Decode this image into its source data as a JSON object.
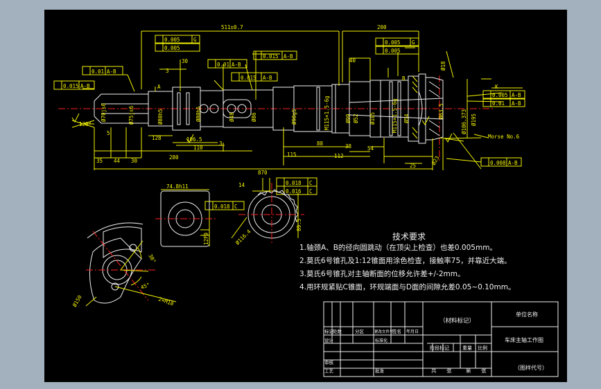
{
  "drawing": {
    "dims": {
      "d511": "511±0.7",
      "d200": "200",
      "d870": "870",
      "d280": "280",
      "d110": "110",
      "d106": "106.5",
      "d128": "128",
      "d88": "88",
      "d115": "115",
      "d38": "38",
      "d54": "54",
      "d112": "112",
      "d25": "25",
      "d35": "35",
      "d44": "44",
      "d30": "30",
      "d3a": "3",
      "d3b": "3",
      "d40": "40",
      "d5": "5",
      "d120": "120°",
      "d748": "74.8h11",
      "d14": "14",
      "d895": "89.5",
      "d1164": "Ø116.4",
      "d12": "12F9",
      "d150": "Ø150",
      "d45": "45°",
      "d30deg": "30°",
      "d2m10": "2×M10",
      "morse": "Morse No.6",
      "phi70": "Ø70js6",
      "phi75": "Ø75js6",
      "phi80": "Ø80h5",
      "phi48": "Ø48",
      "phi86": "Ø86",
      "phi90": "Ø90g5",
      "phi99": "Ø99",
      "phi105": "Ø105",
      "phi195": "Ø195",
      "phi106": "Ø106.373",
      "m115": "M115×1.5-6g",
      "phi18": "Ø18",
      "phi52": "Ø52",
      "phi54": "Ø54",
      "phi63": "Ø63.5",
      "phi23": "Ø23",
      "k": "K"
    },
    "tolerances": {
      "t1": "0.005",
      "t1d": "G",
      "t2": "0.005",
      "t3": "0.015",
      "t3d": "A-B",
      "t4": "0.01",
      "t4d": "A-B",
      "t5": "0.015",
      "t5d": "A-B",
      "t6": "0.01",
      "t6d": "A-B",
      "t7": "0.015",
      "t7d": "A-B",
      "t8": "0.005",
      "t8d": "G",
      "t9": "0.005",
      "t10": "0.005",
      "t10d": "A-B",
      "t11": "0.01",
      "t11d": "A-B",
      "t12": "0.008",
      "t12d": "A-B",
      "t13": "0.018",
      "t13d": "C",
      "t14": "0.016",
      "t14d": "C",
      "t15": "0.018",
      "t15d": "C",
      "label_a": "A",
      "label_b": "B"
    }
  },
  "notes": {
    "title": "技术要求",
    "items": [
      "1.轴颈A、B的径向圆跳动（在顶尖上检查）也差0.005mm。",
      "2.莫氏6号锥孔及1:12锥面用涂色检查，接触率75，并靠近大端。",
      "3.莫氏6号锥孔对主轴断面的位移允许差+/-2mm。",
      "4.用环规紧贴C锥面，环规端面与D面的间隙允差0.05~0.10mm。"
    ]
  },
  "title_block": {
    "material": "（材料标记）",
    "unit_name": "单位名称",
    "drawing_name": "车床主轴工作图",
    "drawing_code": "（图样代号）",
    "mark": "标记",
    "count": "处数",
    "zone": "分区",
    "change_doc": "更改文件号",
    "signature": "签名",
    "date": "年月日",
    "design": "设计",
    "standardize": "标准化",
    "stage_mark": "阶段标记",
    "weight": "重量",
    "scale": "比例",
    "review": "审核",
    "process": "工艺",
    "approve": "批准",
    "total": "共",
    "sheets": "张",
    "sheet_no": "第",
    "sheets2": "张"
  }
}
